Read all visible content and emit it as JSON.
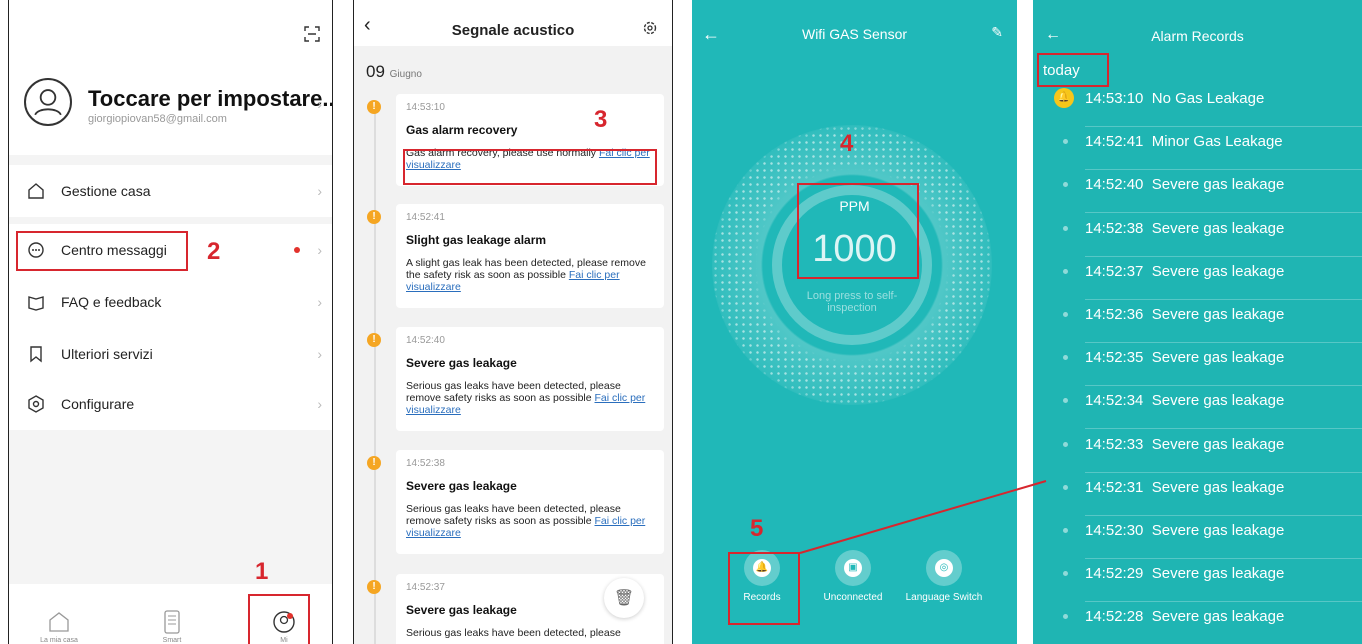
{
  "panel1": {
    "profile": {
      "name": "Toccare per impostare...",
      "email": "giorgiopiovan58@gmail.com"
    },
    "menu": [
      {
        "label": "Gestione casa"
      },
      {
        "label": "Centro messaggi"
      },
      {
        "label": "FAQ e feedback"
      },
      {
        "label": "Ulteriori servizi"
      },
      {
        "label": "Configurare"
      }
    ],
    "tabs": [
      {
        "label": "La mia casa"
      },
      {
        "label": "Smart"
      },
      {
        "label": "Mi"
      }
    ],
    "annotations": {
      "n1": "1",
      "n2": "2"
    }
  },
  "panel2": {
    "title": "Segnale acustico",
    "date_day": "09",
    "date_month": "Giugno",
    "cards": [
      {
        "time": "14:53:10",
        "title": "Gas alarm recovery",
        "body": "Gas alarm recovery, please use normally ",
        "link": "Fai clic per visualizzare"
      },
      {
        "time": "14:52:41",
        "title": "Slight gas leakage alarm",
        "body": "A slight gas leak has been detected, please remove the safety risk as soon as possible ",
        "link": "Fai clic per visualizzare"
      },
      {
        "time": "14:52:40",
        "title": "Severe gas leakage",
        "body": "Serious gas leaks have been detected, please remove safety risks as soon as possible ",
        "link": "Fai clic per visualizzare"
      },
      {
        "time": "14:52:38",
        "title": "Severe gas leakage",
        "body": "Serious gas leaks have been detected, please remove safety risks as soon as possible ",
        "link": "Fai clic per visualizzare"
      },
      {
        "time": "14:52:37",
        "title": "Severe gas leakage",
        "body": "Serious gas leaks have been detected, please",
        "link": ""
      }
    ],
    "annotations": {
      "n3": "3"
    }
  },
  "panel3": {
    "title": "Wifi GAS Sensor",
    "ppm_label": "PPM",
    "ppm_value": "1000",
    "hint": "Long press to self-inspection",
    "buttons": [
      {
        "label": "Records"
      },
      {
        "label": "Unconnected"
      },
      {
        "label": "Language Switch"
      }
    ],
    "annotations": {
      "n4": "4",
      "n5": "5"
    }
  },
  "panel4": {
    "title": "Alarm Records",
    "group": "today",
    "records": [
      {
        "time": "14:53:10",
        "text": "No Gas Leakage"
      },
      {
        "time": "14:52:41",
        "text": "Minor Gas Leakage"
      },
      {
        "time": "14:52:40",
        "text": "Severe gas leakage"
      },
      {
        "time": "14:52:38",
        "text": "Severe gas leakage"
      },
      {
        "time": "14:52:37",
        "text": "Severe gas leakage"
      },
      {
        "time": "14:52:36",
        "text": "Severe gas leakage"
      },
      {
        "time": "14:52:35",
        "text": "Severe gas leakage"
      },
      {
        "time": "14:52:34",
        "text": "Severe gas leakage"
      },
      {
        "time": "14:52:33",
        "text": "Severe gas leakage"
      },
      {
        "time": "14:52:31",
        "text": "Severe gas leakage"
      },
      {
        "time": "14:52:30",
        "text": "Severe gas leakage"
      },
      {
        "time": "14:52:29",
        "text": "Severe gas leakage"
      },
      {
        "time": "14:52:28",
        "text": "Severe gas leakage"
      }
    ]
  },
  "colors": {
    "teal": "#20b8b8",
    "annotation_red": "#d7262e",
    "timeline_orange": "#f5a623",
    "bell_yellow": "#f6c61a"
  }
}
